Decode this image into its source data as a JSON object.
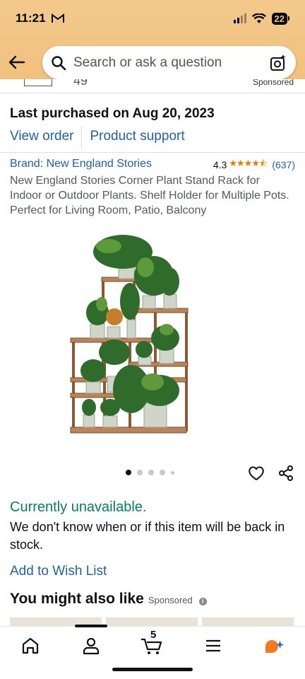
{
  "status_bar": {
    "time": "11:21",
    "mail_icon": "gmail-icon",
    "battery": "22"
  },
  "search": {
    "placeholder": "Search or ask a question",
    "icon": "search-icon",
    "camera_icon": "camera-lens-icon"
  },
  "peek": {
    "number": "49",
    "sponsored": "Sponsored"
  },
  "purchase": {
    "last_purchased": "Last purchased on Aug 20, 2023",
    "view_order": "View order",
    "product_support": "Product support"
  },
  "product": {
    "brand": "Brand: New England Stories",
    "rating": "4.3",
    "stars": "★★★★⯪",
    "review_count": "(637)",
    "title": "New England Stories Corner Plant Stand Rack for Indoor or Outdoor Plants. Shelf Holder for Multiple Pots. Perfect for Living Room, Patio, Balcony"
  },
  "gallery": {
    "image_count": 5,
    "active_index": 0
  },
  "availability": {
    "status": "Currently unavailable.",
    "message": "We don't know when or if this item will be back in stock."
  },
  "wish_list": "Add to Wish List",
  "recommendations": {
    "heading": "You might also like",
    "sponsored": "Sponsored"
  },
  "bottom_nav": {
    "cart_count": "5",
    "items": [
      "home-icon",
      "account-icon",
      "cart-icon",
      "menu-icon",
      "rufus-icon"
    ]
  },
  "colors": {
    "header_bg": "#f1c07e",
    "link": "#2162a1",
    "available_green": "#067d62",
    "star": "#e67a00"
  }
}
